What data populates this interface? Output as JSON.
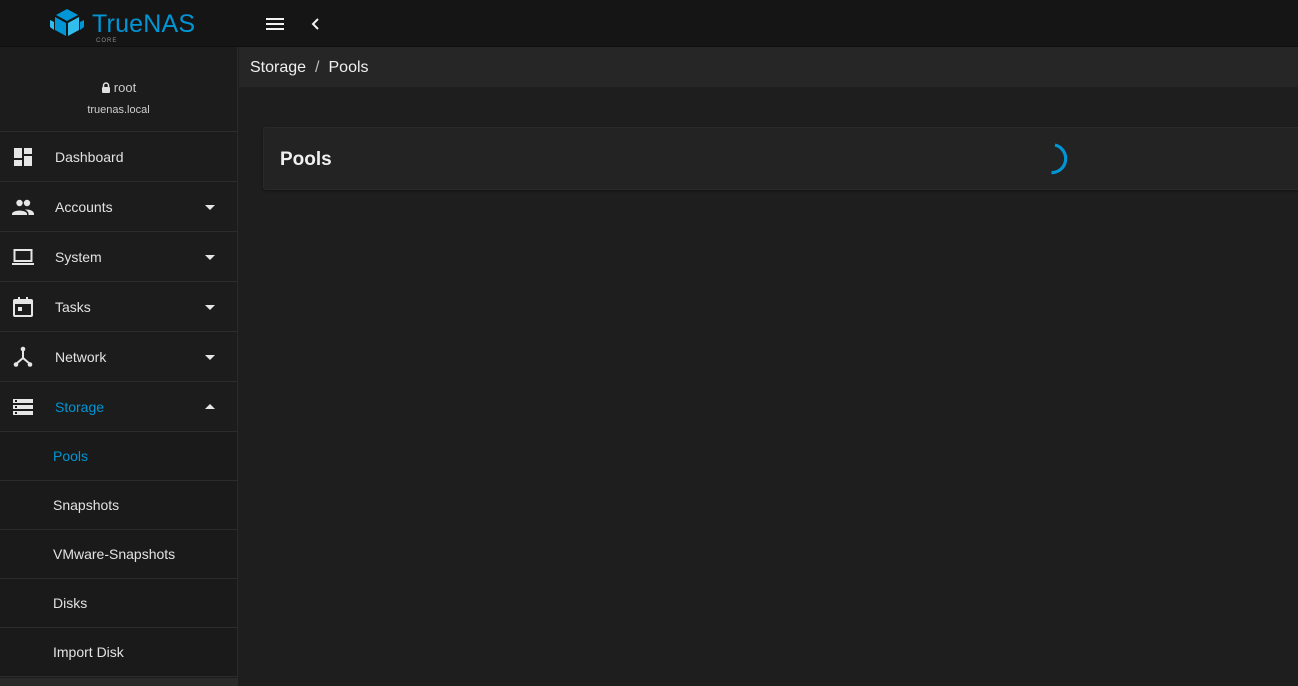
{
  "app": {
    "logo_text": "TrueNAS",
    "logo_sub": "CORE",
    "accent": "#0095d5"
  },
  "topbar": {
    "menu_icon": "hamburger-menu-icon",
    "back_icon": "chevron-left-icon"
  },
  "user": {
    "name": "root",
    "host": "truenas.local"
  },
  "sidebar": {
    "items": [
      {
        "label": "Dashboard",
        "icon": "dashboard-icon"
      },
      {
        "label": "Accounts",
        "icon": "people-icon"
      },
      {
        "label": "System",
        "icon": "laptop-icon"
      },
      {
        "label": "Tasks",
        "icon": "calendar-icon"
      },
      {
        "label": "Network",
        "icon": "network-icon"
      },
      {
        "label": "Storage",
        "icon": "storage-icon"
      }
    ],
    "storage_sub": [
      {
        "label": "Pools"
      },
      {
        "label": "Snapshots"
      },
      {
        "label": "VMware-Snapshots"
      },
      {
        "label": "Disks"
      },
      {
        "label": "Import Disk"
      }
    ]
  },
  "breadcrumb": {
    "parent": "Storage",
    "separator": "/",
    "current": "Pools"
  },
  "main": {
    "card_title": "Pools",
    "loading": true
  }
}
